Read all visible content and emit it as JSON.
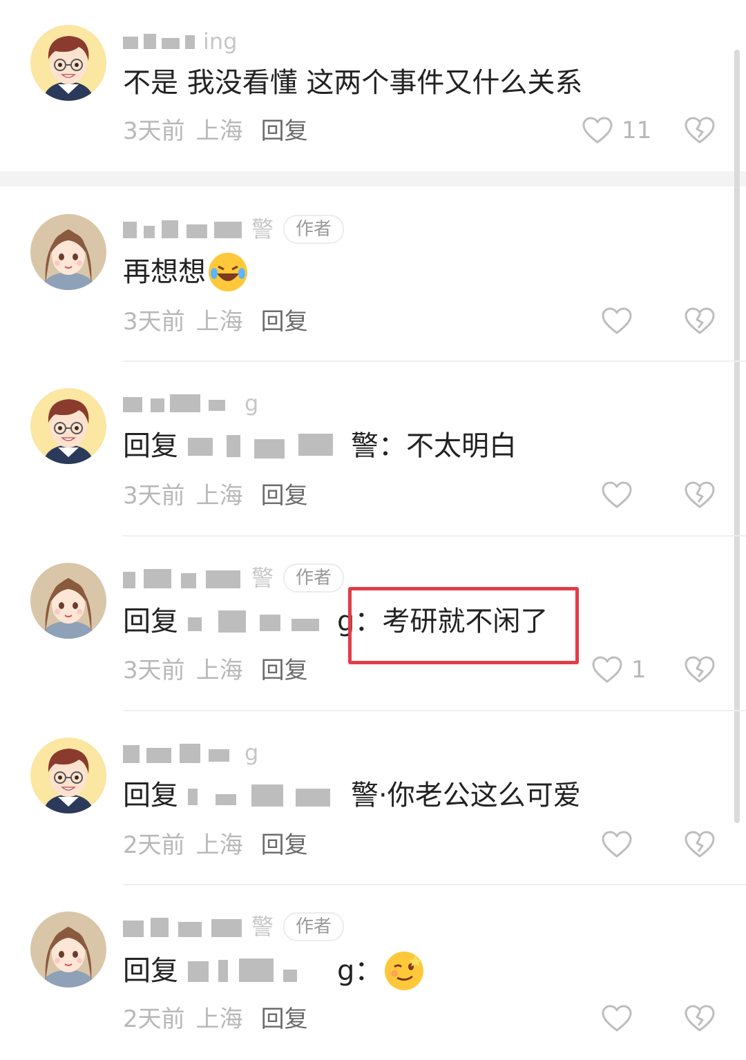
{
  "comments": [
    {
      "name_visible": "ing",
      "author": false,
      "text": "不是 我没看懂 这两个事件又什么关系",
      "reply_prefix": "",
      "reply_target_visible": "",
      "time": "3天前",
      "location": "上海",
      "reply_label": "回复",
      "likes": "11",
      "avatar": "boy-glasses"
    },
    {
      "name_visible": "警",
      "author": true,
      "author_label": "作者",
      "text": "再想想",
      "emoji": "rolling-laughing-emoji",
      "reply_prefix": "",
      "time": "3天前",
      "location": "上海",
      "reply_label": "回复",
      "likes": "",
      "avatar": "girl-brown-hair"
    },
    {
      "name_visible": "g",
      "author": false,
      "reply_prefix": "回复",
      "reply_target_visible": "警：",
      "text": "不太明白",
      "time": "3天前",
      "location": "上海",
      "reply_label": "回复",
      "likes": "",
      "avatar": "boy-glasses"
    },
    {
      "name_visible": "警",
      "author": true,
      "author_label": "作者",
      "reply_prefix": "回复",
      "reply_target_visible": "g：",
      "text": "考研就不闲了",
      "time": "3天前",
      "location": "上海",
      "reply_label": "回复",
      "likes": "1",
      "avatar": "girl-brown-hair"
    },
    {
      "name_visible": "g",
      "author": false,
      "reply_prefix": "回复",
      "reply_target_visible": "警·",
      "text": "你老公这么可爱",
      "time": "2天前",
      "location": "上海",
      "reply_label": "回复",
      "likes": "",
      "avatar": "boy-glasses"
    },
    {
      "name_visible": "警",
      "author": true,
      "author_label": "作者",
      "reply_prefix": "回复",
      "reply_target_visible": "g：",
      "text": "",
      "emoji": "winking-smirk-emoji",
      "time": "2天前",
      "location": "上海",
      "reply_label": "回复",
      "likes": "",
      "avatar": "girl-brown-hair"
    }
  ],
  "colors": {
    "highlight_border": "#e23c48",
    "meta_text": "#b8b8b8",
    "reply_text": "#6a6a6a",
    "body_text": "#222222"
  }
}
